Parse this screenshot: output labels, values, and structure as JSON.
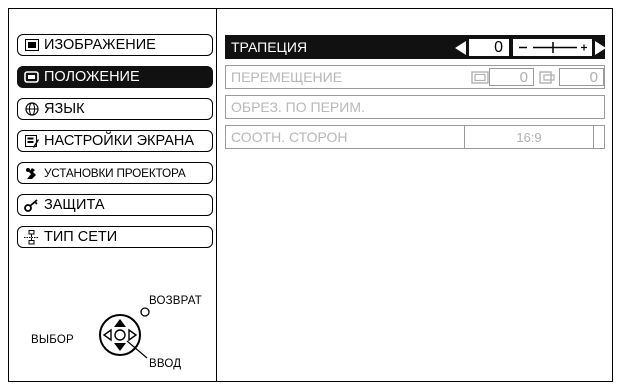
{
  "menu": {
    "items": [
      {
        "label": "ИЗОБРАЖЕНИЕ",
        "icon": "picture-icon"
      },
      {
        "label": "ПОЛОЖЕНИЕ",
        "icon": "position-icon",
        "selected": true
      },
      {
        "label": "ЯЗЫК",
        "icon": "globe-icon"
      },
      {
        "label": "НАСТРОЙКИ ЭКРАНА",
        "icon": "screen-settings-icon"
      },
      {
        "label": "УСТАНОВКИ ПРОЕКТОРА",
        "icon": "projector-settings-icon"
      },
      {
        "label": "ЗАЩИТА",
        "icon": "key-icon"
      },
      {
        "label": "ТИП СЕТИ",
        "icon": "network-icon"
      }
    ]
  },
  "navigation": {
    "back_label": "ВОЗВРАТ",
    "select_label": "ВЫБОР",
    "enter_label": "ВВОД"
  },
  "settings": {
    "keystone": {
      "label": "ТРАПЕЦИЯ",
      "value": "0"
    },
    "shift": {
      "label": "ПЕРЕМЕЩЕНИЕ",
      "h_value": "0",
      "v_value": "0"
    },
    "crop": {
      "label": "ОБРЕЗ. ПО ПЕРИМ."
    },
    "aspect": {
      "label": "СООТН. СТОРОН",
      "value": "16:9"
    }
  },
  "colors": {
    "selected_bg": "#111111",
    "disabled_text": "#b8b8b8"
  }
}
